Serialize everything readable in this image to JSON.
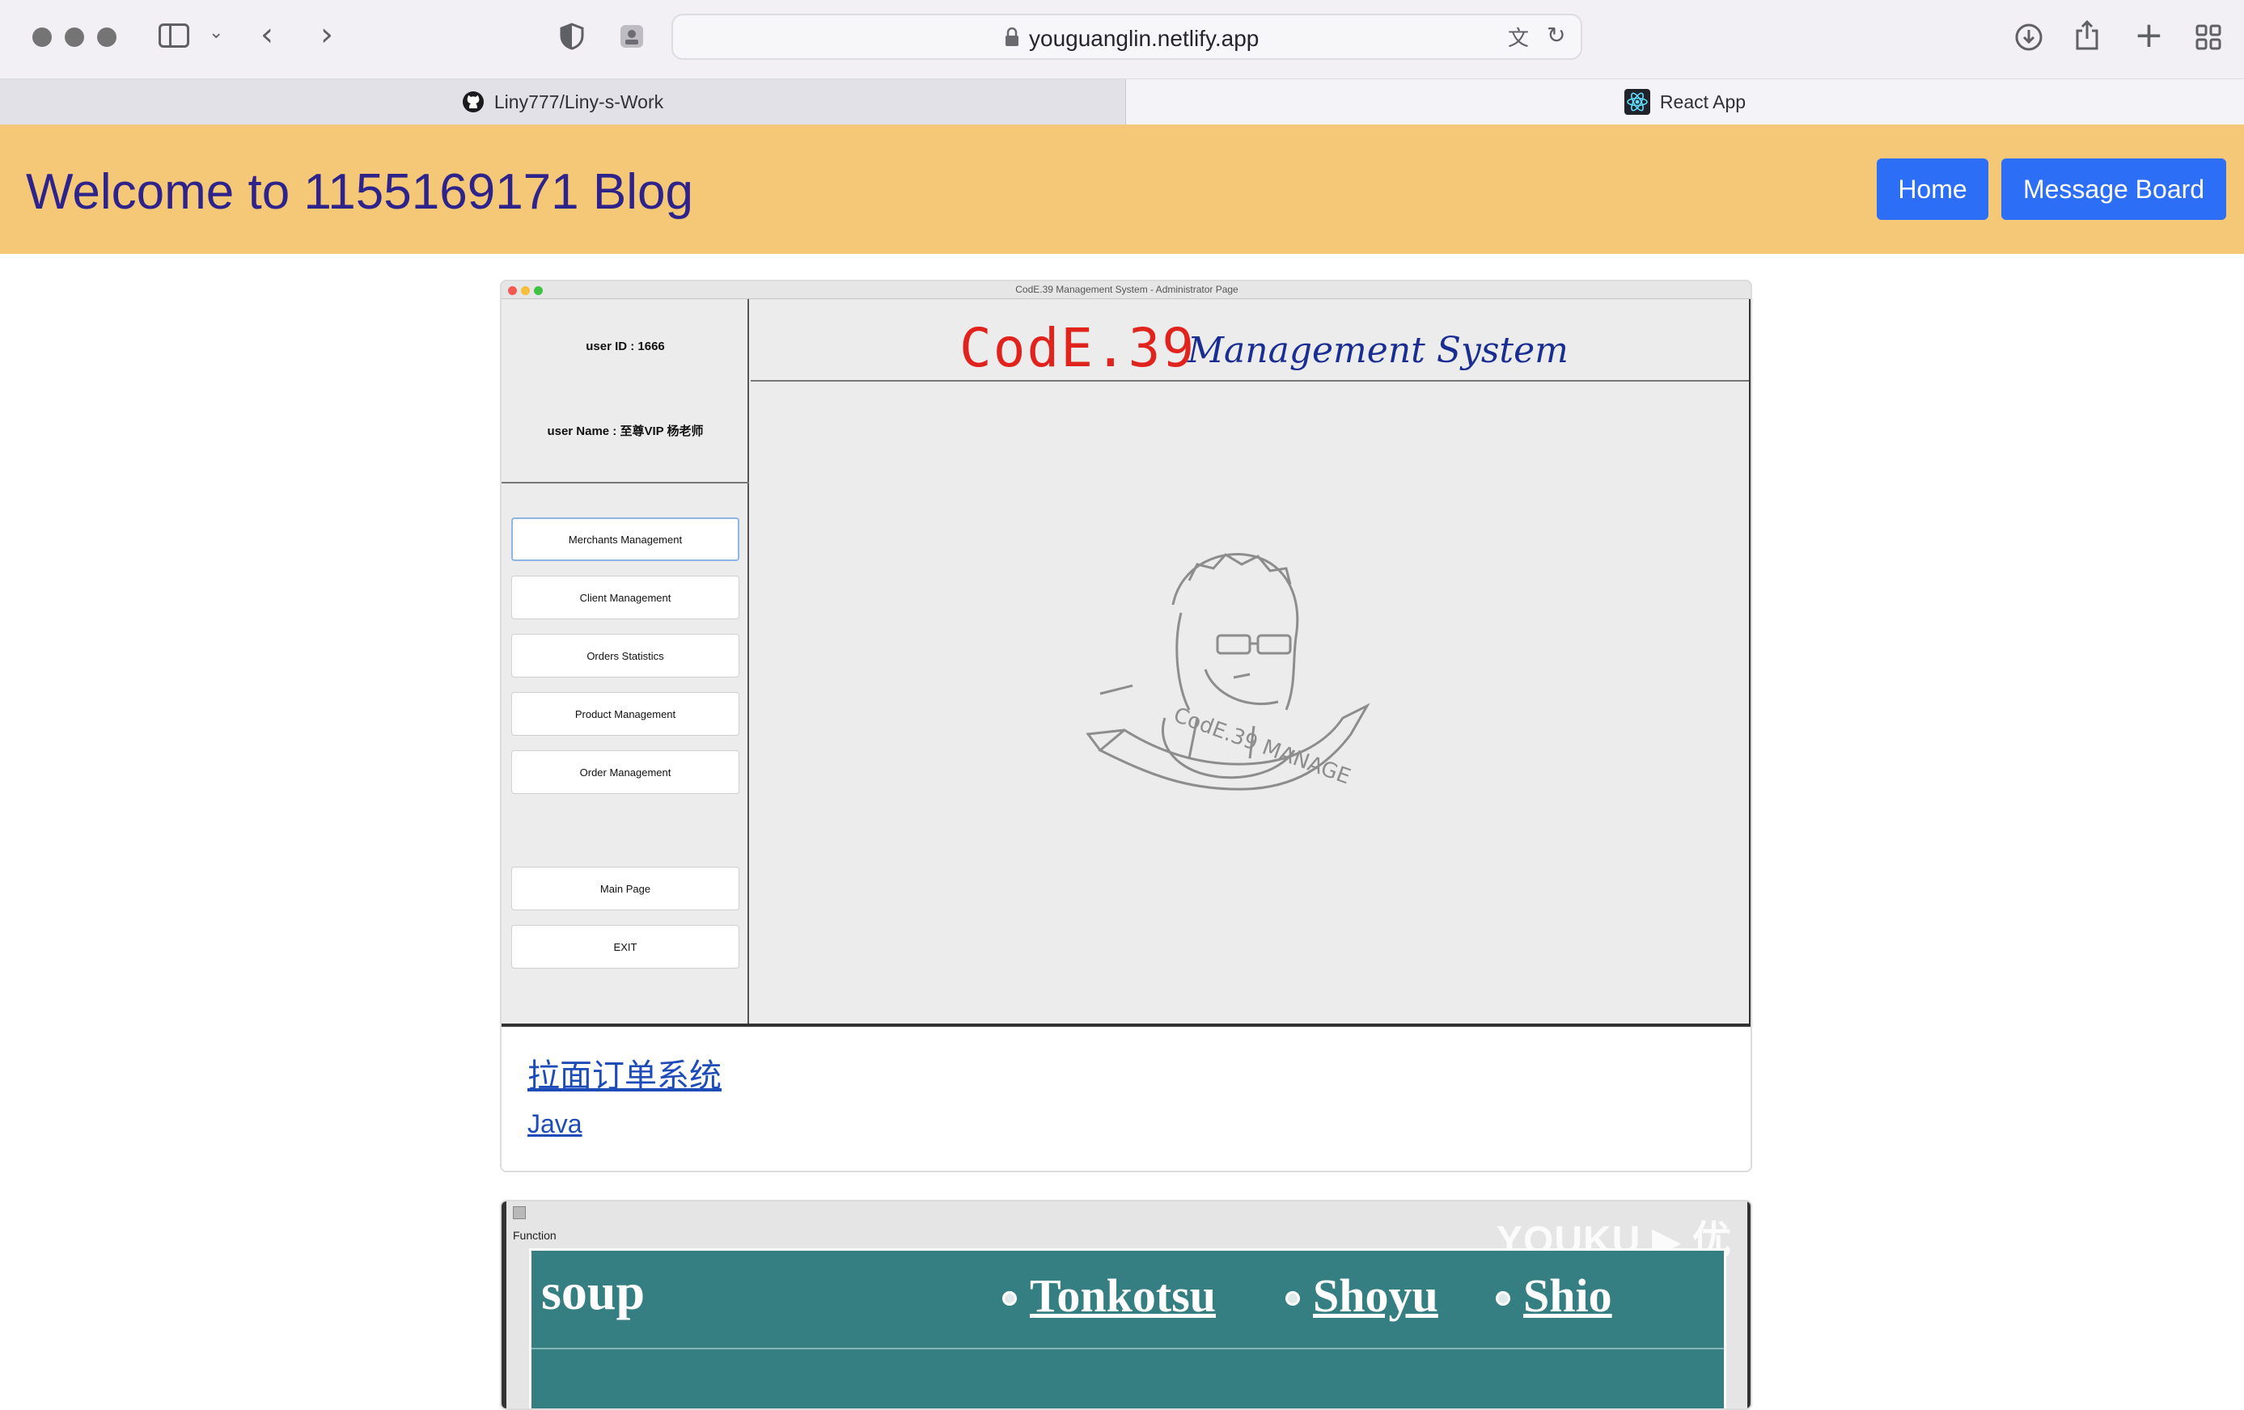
{
  "browser": {
    "url": "youguanglin.netlify.app",
    "tabs": [
      {
        "label": "Liny777/Liny-s-Work",
        "icon": "github-icon"
      },
      {
        "label": "React App",
        "icon": "react-icon"
      }
    ]
  },
  "header": {
    "title": "Welcome to 1155169171 Blog",
    "nav": {
      "home": "Home",
      "message_board": "Message Board"
    },
    "background_color": "#f4c877",
    "button_color": "#2c6ef5"
  },
  "projects": [
    {
      "title": "拉面订单系统",
      "tag": "Java",
      "screenshot": {
        "window_title": "CodE.39 Management System - Administrator Page",
        "user_id": "user ID : 1666",
        "user_name": "user Name : 至尊VIP 杨老师",
        "menu": [
          "Merchants Management",
          "Client Management",
          "Orders Statistics",
          "Product Management",
          "Order Management"
        ],
        "bottom_menu": [
          "Main Page",
          "EXIT"
        ],
        "logo_code": "CodE.39",
        "logo_ms": "Management System",
        "banner_text": "CodE.39 MANAGE"
      }
    },
    {
      "screenshot": {
        "watermark": "YOUKU",
        "watermark_cjk": "优",
        "function_label": "Function",
        "row_label": "soup",
        "options": [
          "Tonkotsu",
          "Shoyu",
          "Shio"
        ]
      }
    }
  ]
}
